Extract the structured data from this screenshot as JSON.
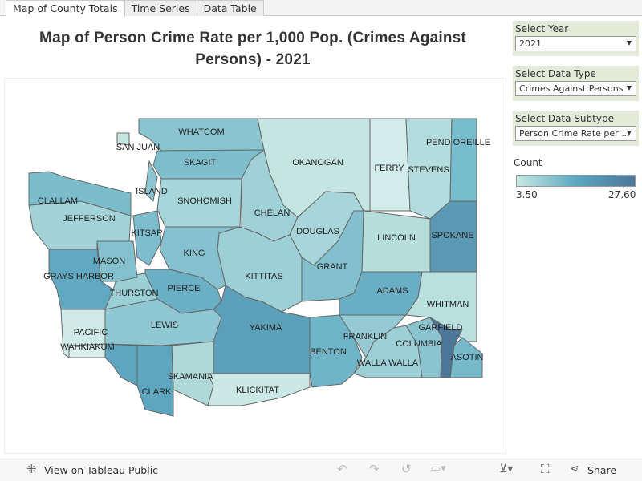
{
  "tabs": [
    "Map of County Totals",
    "Time Series",
    "Data Table"
  ],
  "title_line1": "Map of Person Crime Rate per 1,000 Pop. (Crimes Against",
  "title_line2": "Persons) - 2021",
  "filters": {
    "year": {
      "label": "Select Year",
      "value": "2021"
    },
    "type": {
      "label": "Select Data Type",
      "value": "Crimes Against Persons"
    },
    "subtype": {
      "label": "Select Data Subtype",
      "value": "Person Crime Rate per ..."
    }
  },
  "legend": {
    "title": "Count",
    "min": "3.50",
    "max": "27.60",
    "colors": [
      "#c8e8e2",
      "#5aa8c0",
      "#4e7699"
    ]
  },
  "counties": [
    {
      "name": "WHATCOM",
      "color": "#8ac4d0"
    },
    {
      "name": "SKAGIT",
      "color": "#7dbdcc"
    },
    {
      "name": "SNOHOMISH",
      "color": "#a6d6d9"
    },
    {
      "name": "OKANOGAN",
      "color": "#c5e6e0"
    },
    {
      "name": "FERRY",
      "color": "#d2ecea"
    },
    {
      "name": "STEVENS",
      "color": "#b2dcdd"
    },
    {
      "name": "PEND OREILLE",
      "color": "#78bdcd"
    },
    {
      "name": "SPOKANE",
      "color": "#5a98b3"
    },
    {
      "name": "LINCOLN",
      "color": "#b6dedd"
    },
    {
      "name": "CHELAN",
      "color": "#9fd0d7"
    },
    {
      "name": "DOUGLAS",
      "color": "#a7d5d9"
    },
    {
      "name": "GRANT",
      "color": "#83c0ce"
    },
    {
      "name": "ADAMS",
      "color": "#6aaec4"
    },
    {
      "name": "WHITMAN",
      "color": "#b9dfdf"
    },
    {
      "name": "KITTITAS",
      "color": "#9ccfd6"
    },
    {
      "name": "KING",
      "color": "#86c1cf"
    },
    {
      "name": "PIERCE",
      "color": "#6aafc4"
    },
    {
      "name": "YAKIMA",
      "color": "#5b9fb8"
    },
    {
      "name": "BENTON",
      "color": "#70b4c8"
    },
    {
      "name": "FRANKLIN",
      "color": "#95cad5"
    },
    {
      "name": "WALLA WALLA",
      "color": "#9dcfd7"
    },
    {
      "name": "COLUMBIA",
      "color": "#8ac4d0"
    },
    {
      "name": "GARFIELD",
      "color": "#4d7798"
    },
    {
      "name": "ASOTIN",
      "color": "#76b9cb"
    },
    {
      "name": "LEWIS",
      "color": "#8fc7d2"
    },
    {
      "name": "SKAMANIA",
      "color": "#b0dad9"
    },
    {
      "name": "KLICKITAT",
      "color": "#cbe8e4"
    },
    {
      "name": "CLARK",
      "color": "#5ea6bf"
    },
    {
      "name": "",
      "color": "#5ea6bf"
    },
    {
      "name": "WAHKIAKUM",
      "color": "#d8efec"
    },
    {
      "name": "PACIFIC",
      "color": "#d0ebe7"
    },
    {
      "name": "GRAYS HARBOR",
      "color": "#62a8c0"
    },
    {
      "name": "THURSTON",
      "color": "#9bcfd6"
    },
    {
      "name": "MASON",
      "color": "#84c1cf"
    },
    {
      "name": "JEFFERSON",
      "color": "#a3d3d8"
    },
    {
      "name": "CLALLAM",
      "color": "#7cbdcc"
    },
    {
      "name": "KITSAP",
      "color": "#7ebdcd"
    },
    {
      "name": "SAN JUAN",
      "color": "#c5e6e0"
    },
    {
      "name": "ISLAND",
      "color": "#8dc5d0"
    }
  ],
  "footer": {
    "view": "View on Tableau Public",
    "share": "Share"
  }
}
